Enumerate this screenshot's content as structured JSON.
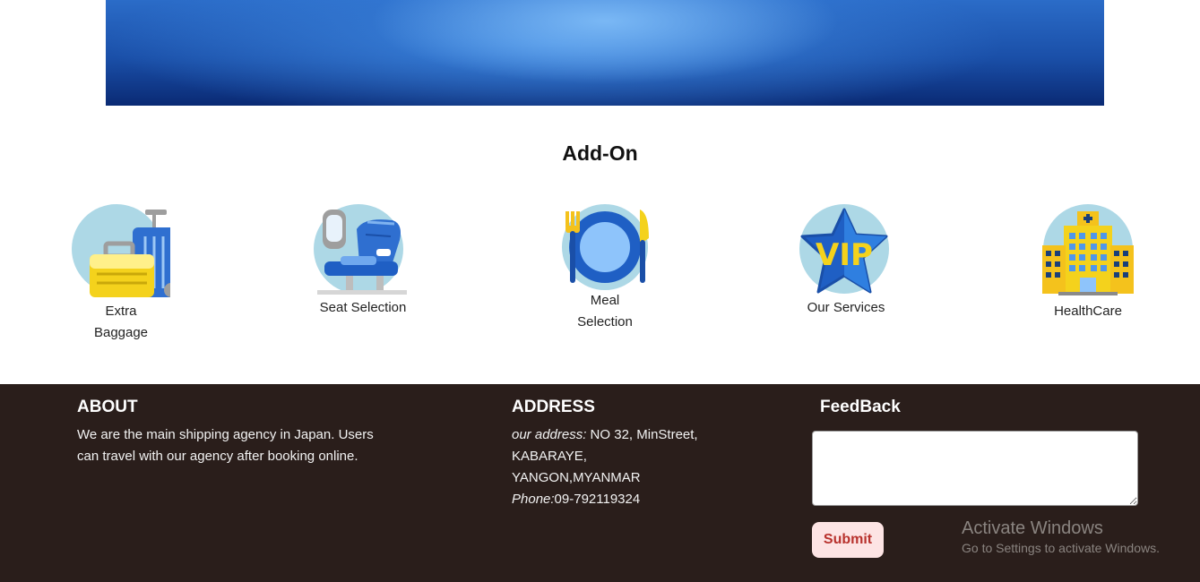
{
  "addon": {
    "title": "Add-On",
    "items": [
      {
        "icon": "luggage-icon",
        "line1": "Extra",
        "line2": "Baggage"
      },
      {
        "icon": "airplane-seat-icon",
        "line1": "Seat Selection",
        "line2": ""
      },
      {
        "icon": "meal-plate-icon",
        "line1": "Meal",
        "line2": "Selection"
      },
      {
        "icon": "vip-star-icon",
        "line1": "Our Services",
        "line2": ""
      },
      {
        "icon": "hospital-building-icon",
        "line1": "HealthCare",
        "line2": ""
      }
    ]
  },
  "footer": {
    "about": {
      "heading": "ABOUT",
      "line1": "We are the main shipping agency in Japan. Users",
      "line2": "can travel with our agency after booking online."
    },
    "address": {
      "heading": "ADDRESS",
      "address_label": "our address:",
      "address_line1": " NO 32, MinStreet,",
      "address_line2": "KABARAYE,",
      "address_line3": "YANGON,MYANMAR",
      "phone_label": "Phone:",
      "phone_value": "09-792119324"
    },
    "feedback": {
      "heading": "FeedBack",
      "textarea_value": "",
      "submit_label": "Submit"
    }
  },
  "watermark": {
    "title": "Activate Windows",
    "subtitle": "Go to Settings to activate Windows."
  },
  "colors": {
    "footer_bg": "#2a1e1b",
    "submit_bg": "#fde4e4",
    "submit_text": "#b8322d",
    "icon_circle": "#add8e6"
  }
}
